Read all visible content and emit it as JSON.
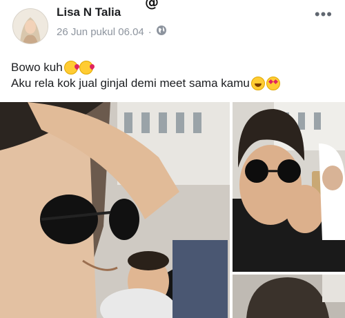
{
  "watermark": "@",
  "post": {
    "author": "Lisa N Talia",
    "timestamp": "26 Jun pukul 06.04",
    "separator": "·",
    "privacy_icon": "globe-icon",
    "more_label": "•••",
    "text_line1": "Bowo kuh",
    "text_line2": "Aku rela kok jual ginjal demi meet sama kamu",
    "line1_emojis": [
      "kiss-emoji",
      "kiss-emoji"
    ],
    "line2_emojis": [
      "laughing-emoji",
      "heart-eyes-emoji"
    ]
  },
  "photos": [
    "main-photo",
    "top-right-photo",
    "bottom-right-photo"
  ]
}
